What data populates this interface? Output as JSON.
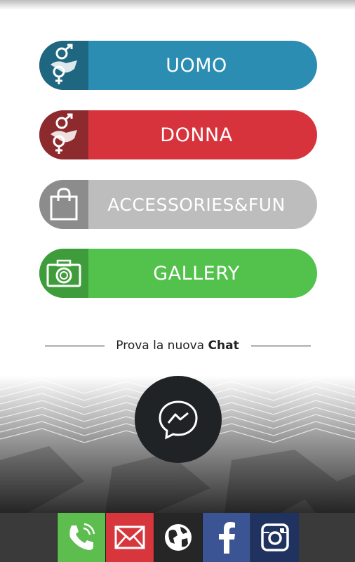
{
  "menu": {
    "uomo": {
      "label": "UOMO",
      "icon": "gender-symbols-icon",
      "color": "#2b8db1"
    },
    "donna": {
      "label": "DONNA",
      "icon": "gender-symbols-icon",
      "color": "#d7333c"
    },
    "accessories": {
      "label": "ACCESSORIES&FUN",
      "icon": "shopping-bag-icon",
      "color": "#bdbdbd"
    },
    "gallery": {
      "label": "GALLERY",
      "icon": "camera-icon",
      "color": "#53c24d"
    }
  },
  "chat_promo": {
    "prefix": "Prova la nuova ",
    "bold": "Chat",
    "icon": "messenger-icon"
  },
  "bottom_bar": [
    {
      "name": "phone-icon",
      "color": "#5dbd4f"
    },
    {
      "name": "mail-icon",
      "color": "#d6363c"
    },
    {
      "name": "globe-icon",
      "color": "#262626"
    },
    {
      "name": "facebook-icon",
      "color": "#3b5494"
    },
    {
      "name": "instagram-icon",
      "color": "#1f3260"
    }
  ]
}
